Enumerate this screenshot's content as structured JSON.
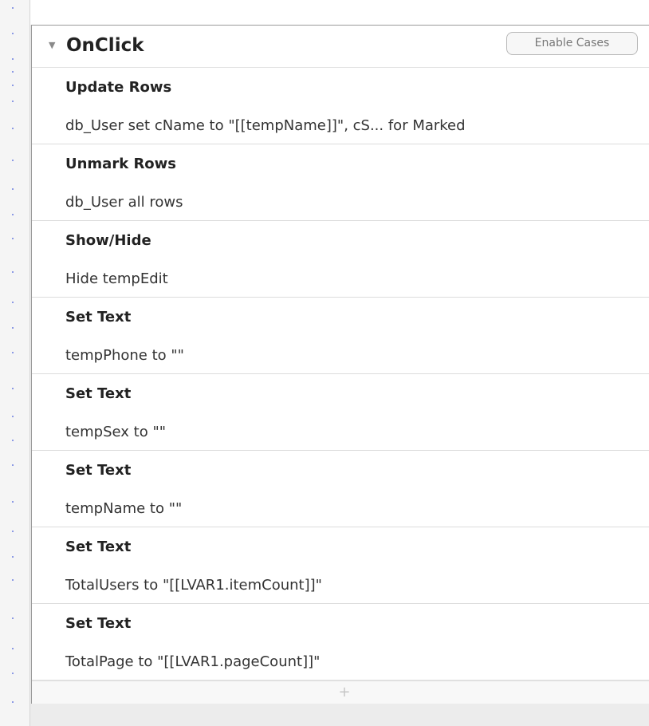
{
  "event": {
    "title": "OnClick",
    "enable_cases_label": "Enable Cases",
    "collapse_icon": "triangle-down-icon"
  },
  "actions": [
    {
      "title": "Update Rows",
      "description": "db_User set cName to \"[[tempName]]\", cS... for Marked"
    },
    {
      "title": "Unmark Rows",
      "description": "db_User all rows"
    },
    {
      "title": "Show/Hide",
      "description": "Hide tempEdit"
    },
    {
      "title": "Set Text",
      "description": "tempPhone to \"\""
    },
    {
      "title": "Set Text",
      "description": "tempSex to \"\""
    },
    {
      "title": "Set Text",
      "description": "tempName to \"\""
    },
    {
      "title": "Set Text",
      "description": "TotalUsers to \"[[LVAR1.itemCount]]\""
    },
    {
      "title": "Set Text",
      "description": "TotalPage to \"[[LVAR1.pageCount]]\""
    }
  ],
  "add_row": {
    "icon": "plus-icon",
    "label": "+"
  },
  "colors": {
    "ruler_dot": "#6a7de0",
    "panel_border": "#9a9a9a",
    "divider": "#dcdcdc"
  }
}
